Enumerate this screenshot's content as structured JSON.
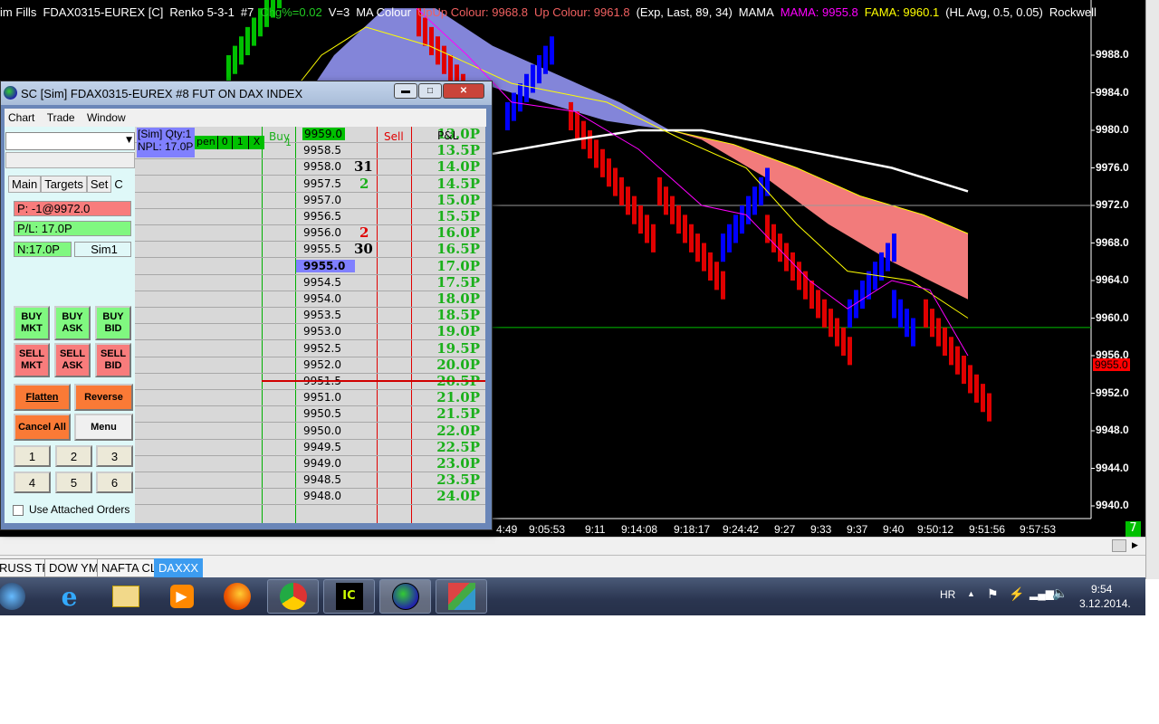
{
  "chart": {
    "header": [
      {
        "text": "im Fills",
        "color": "#ffffff"
      },
      {
        "text": "FDAX0315-EUREX [C]",
        "color": "#ffffff"
      },
      {
        "text": "Renko 5-3-1",
        "color": "#ffffff"
      },
      {
        "text": "#7",
        "color": "#ffffff"
      },
      {
        "text": "Chg%=0.02",
        "color": "#22cc22"
      },
      {
        "text": "V=3",
        "color": "#ffffff"
      },
      {
        "text": "MA Colour",
        "color": "#ffffff"
      },
      {
        "text": "UpUp Colour: 9968.8",
        "color": "#f06060"
      },
      {
        "text": "Up Colour: 9961.8",
        "color": "#f06060"
      },
      {
        "text": "(Exp, Last, 89, 34)",
        "color": "#ffffff"
      },
      {
        "text": "MAMA",
        "color": "#ffffff"
      },
      {
        "text": "MAMA: 9955.8",
        "color": "#ff00ff"
      },
      {
        "text": "FAMA: 9960.1",
        "color": "#ffff00"
      },
      {
        "text": "(HL Avg, 0.5, 0.05)",
        "color": "#ffffff"
      },
      {
        "text": "Rockwell",
        "color": "#ffffff"
      }
    ],
    "current_price": "9955.0",
    "badge": "7",
    "time_labels": [
      "4:49",
      "9:05:53",
      "9:11",
      "9:14:08",
      "9:18:17",
      "9:24:42",
      "9:27",
      "9:33",
      "9:37",
      "9:40",
      "9:50:12",
      "9:51:56",
      "9:57:53"
    ]
  },
  "chart_data": {
    "type": "line",
    "title": "FDAX0315-EUREX [C] Renko 5-3-1",
    "ylim": [
      9936,
      9994
    ],
    "y_ticks": [
      "9988.0",
      "9984.0",
      "9980.0",
      "9976.0",
      "9972.0",
      "9968.0",
      "9964.0",
      "9960.0",
      "9956.0",
      "9952.0",
      "9948.0",
      "9944.0",
      "9940.0"
    ],
    "renko_segments": [
      {
        "color": "#00c000",
        "from": 9985,
        "to": 9993,
        "start": 0
      },
      {
        "color": "#e00000",
        "from": 9993,
        "to": 9984,
        "start": 30
      },
      {
        "color": "#0000ff",
        "from": 9980,
        "to": 9987,
        "start": 44
      },
      {
        "color": "#e00000",
        "from": 9983,
        "to": 9970,
        "start": 54
      },
      {
        "color": "#e00000",
        "from": 9975,
        "to": 9965,
        "start": 68
      },
      {
        "color": "#0000ff",
        "from": 9966,
        "to": 9973,
        "start": 78
      },
      {
        "color": "#e00000",
        "from": 9971,
        "to": 9958,
        "start": 85
      },
      {
        "color": "#0000ff",
        "from": 9959,
        "to": 9966,
        "start": 98
      },
      {
        "color": "#0000ff",
        "from": 9963,
        "to": 9960,
        "start": 105
      },
      {
        "color": "#e00000",
        "from": 9962,
        "to": 9952,
        "start": 110
      }
    ],
    "cloud_blue": {
      "upper": [
        [
          11,
          9982
        ],
        [
          17,
          9988
        ],
        [
          25,
          9993
        ],
        [
          33,
          9993
        ],
        [
          42,
          9989
        ],
        [
          52,
          9986
        ],
        [
          62,
          9983
        ],
        [
          70,
          9980
        ]
      ],
      "lower": [
        [
          70,
          9980
        ],
        [
          60,
          9981
        ],
        [
          50,
          9983
        ],
        [
          40,
          9985
        ],
        [
          25,
          9984
        ],
        [
          11,
          9982
        ]
      ]
    },
    "cloud_red": {
      "upper": [
        [
          70,
          9980
        ],
        [
          80,
          9978.5
        ],
        [
          90,
          9976
        ],
        [
          100,
          9973
        ],
        [
          110,
          9971
        ],
        [
          117,
          9969
        ]
      ],
      "lower": [
        [
          117,
          9962
        ],
        [
          105,
          9966
        ],
        [
          95,
          9970
        ],
        [
          85,
          9975
        ],
        [
          75,
          9979
        ],
        [
          70,
          9980
        ]
      ]
    },
    "white_line": [
      [
        42,
        9977.5
      ],
      [
        55,
        9979
      ],
      [
        65,
        9980
      ],
      [
        75,
        9980
      ],
      [
        90,
        9978
      ],
      [
        105,
        9976
      ],
      [
        117,
        9973.5
      ]
    ],
    "yellow_line": [
      [
        8,
        9982
      ],
      [
        15,
        9988
      ],
      [
        22,
        9991
      ],
      [
        32,
        9989
      ],
      [
        45,
        9985
      ],
      [
        60,
        9983
      ],
      [
        72,
        9979
      ],
      [
        82,
        9976
      ],
      [
        90,
        9970
      ],
      [
        98,
        9965
      ],
      [
        108,
        9964
      ],
      [
        117,
        9960
      ]
    ],
    "magenta_line": [
      [
        30,
        9993
      ],
      [
        38,
        9988
      ],
      [
        45,
        9983
      ],
      [
        55,
        9982
      ],
      [
        65,
        9978
      ],
      [
        75,
        9972
      ],
      [
        82,
        9971
      ],
      [
        92,
        9964
      ],
      [
        98,
        9961
      ],
      [
        105,
        9964
      ],
      [
        111,
        9963
      ],
      [
        117,
        9956
      ]
    ],
    "h_lines": [
      {
        "price": 9972,
        "color": "#999999"
      },
      {
        "price": 9959,
        "color": "#00c000"
      }
    ]
  },
  "dom": {
    "title": "SC [Sim] FDAX0315-EUREX  #8  FUT ON DAX INDEX",
    "menu": [
      "Chart",
      "Trade",
      "Window"
    ],
    "tabs": [
      "Main",
      "Targets",
      "Set",
      "C"
    ],
    "position": "P: -1@9972.0",
    "pl": "P/L: 17.0P",
    "n": "N:17.0P",
    "account": "Sim1",
    "buy_buttons": [
      "BUY MKT",
      "BUY ASK",
      "BUY BID"
    ],
    "sell_buttons": [
      "SELL MKT",
      "SELL ASK",
      "SELL BID"
    ],
    "flatten": "Flatten",
    "reverse": "Reverse",
    "cancel_all": "Cancel All",
    "menu_btn": "Menu",
    "qty_buttons": [
      "1",
      "2",
      "3",
      "4",
      "5",
      "6"
    ],
    "attached_orders": "Use Attached Orders",
    "sim_info": "[Sim]  Qty:1",
    "npl": "NPL: 17.0P",
    "open_btns": [
      "pen",
      "0",
      "1",
      "X"
    ],
    "col_buy": "Buy",
    "col_buy_sub": "1",
    "col_sell": "Sell",
    "col_pnl": "P&L",
    "rows": [
      {
        "price": "9959.0",
        "qty": "",
        "pnl": "13.0P"
      },
      {
        "price": "9958.5",
        "qty": "",
        "pnl": "13.5P"
      },
      {
        "price": "9958.0",
        "qty": "31",
        "pnl": "14.0P"
      },
      {
        "price": "9957.5",
        "qty": "2",
        "pnl": "14.5P"
      },
      {
        "price": "9957.0",
        "qty": "",
        "pnl": "15.0P"
      },
      {
        "price": "9956.5",
        "qty": "",
        "pnl": "15.5P"
      },
      {
        "price": "9956.0",
        "qty": "2",
        "pnl": "16.0P"
      },
      {
        "price": "9955.5",
        "qty": "30",
        "pnl": "16.5P"
      },
      {
        "price": "9955.0",
        "qty": "",
        "pnl": "17.0P"
      },
      {
        "price": "9954.5",
        "qty": "",
        "pnl": "17.5P"
      },
      {
        "price": "9954.0",
        "qty": "",
        "pnl": "18.0P"
      },
      {
        "price": "9953.5",
        "qty": "",
        "pnl": "18.5P"
      },
      {
        "price": "9953.0",
        "qty": "",
        "pnl": "19.0P"
      },
      {
        "price": "9952.5",
        "qty": "",
        "pnl": "19.5P"
      },
      {
        "price": "9952.0",
        "qty": "",
        "pnl": "20.0P"
      },
      {
        "price": "9951.5",
        "qty": "",
        "pnl": "20.5P"
      },
      {
        "price": "9951.0",
        "qty": "",
        "pnl": "21.0P"
      },
      {
        "price": "9950.5",
        "qty": "",
        "pnl": "21.5P"
      },
      {
        "price": "9950.0",
        "qty": "",
        "pnl": "22.0P"
      },
      {
        "price": "9949.5",
        "qty": "",
        "pnl": "22.5P"
      },
      {
        "price": "9949.0",
        "qty": "",
        "pnl": "23.0P"
      },
      {
        "price": "9948.5",
        "qty": "",
        "pnl": "23.5P"
      },
      {
        "price": "9948.0",
        "qty": "",
        "pnl": "24.0P"
      }
    ],
    "qty_colors": {
      "9958.0": "#000000",
      "9957.5": "#1bb01b",
      "9956.0": "#e00000",
      "9955.5": "#000000"
    }
  },
  "tabs": [
    "RUSS TF",
    "DOW YM",
    "NAFTA CL",
    "DAXXX"
  ],
  "taskbar": {
    "lang": "HR",
    "time": "9:54",
    "date": "3.12.2014."
  }
}
